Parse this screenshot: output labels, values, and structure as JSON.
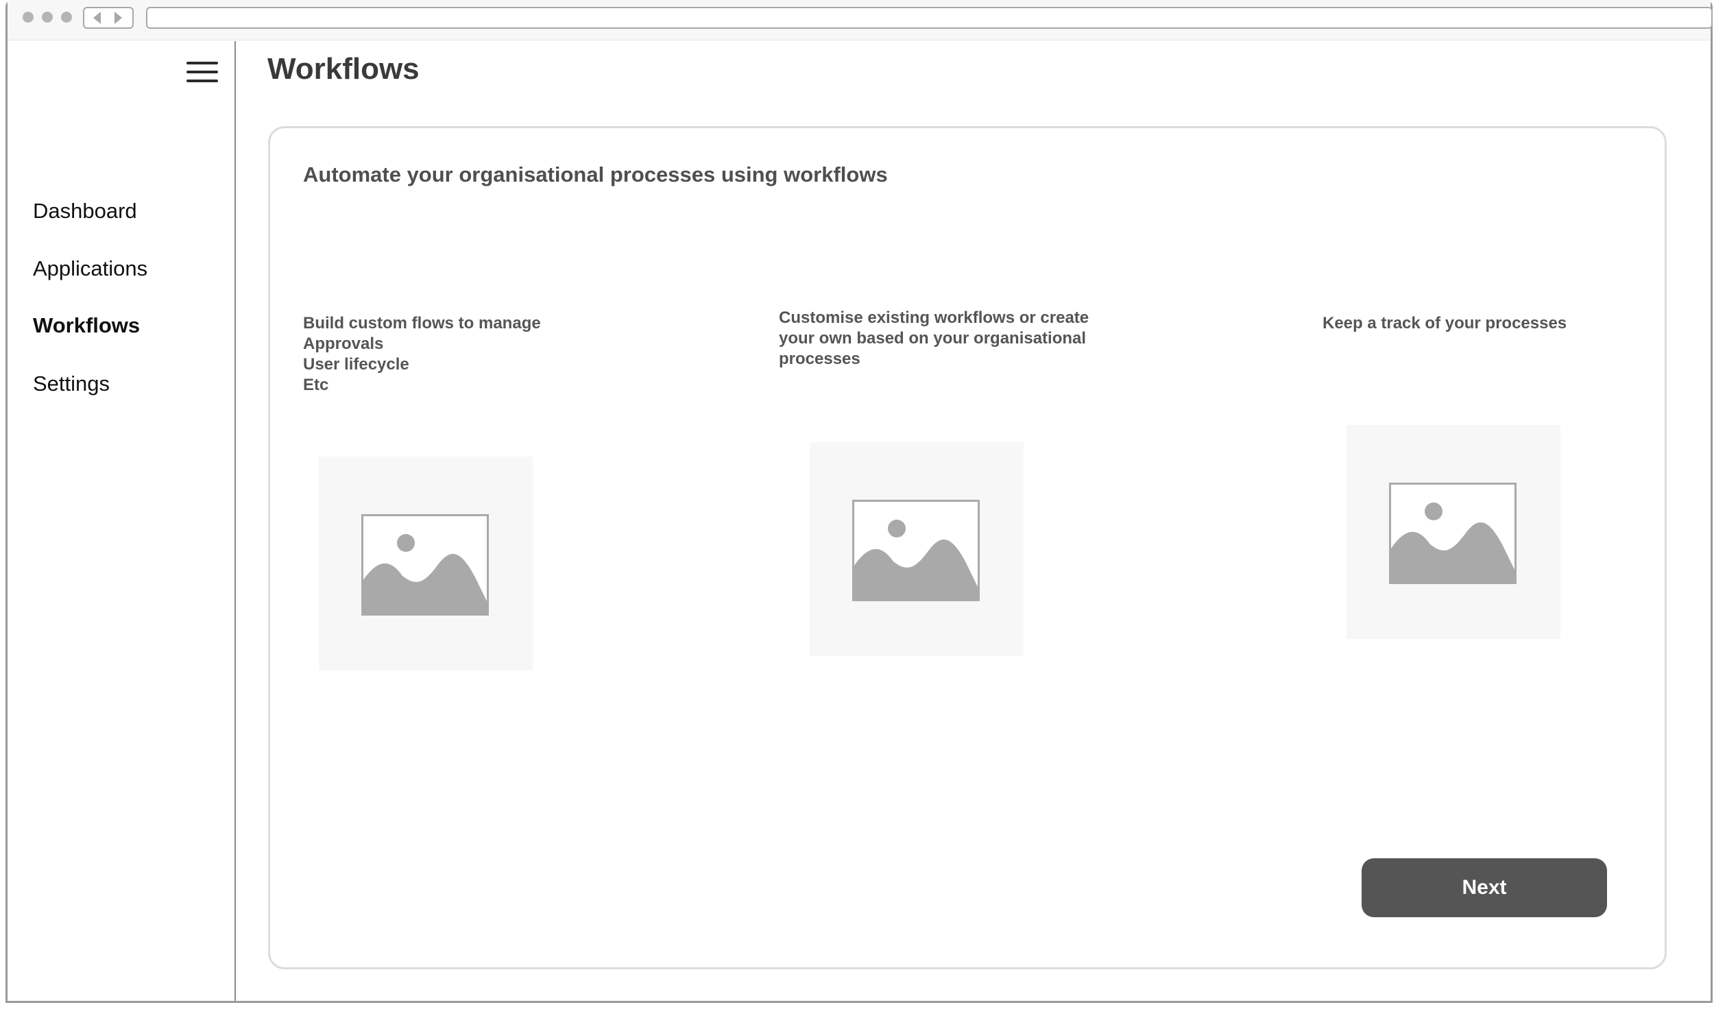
{
  "sidebar": {
    "menu_icon": "hamburger-menu-icon",
    "items": [
      {
        "label": "Dashboard",
        "active": false
      },
      {
        "label": "Applications",
        "active": false
      },
      {
        "label": "Workflows",
        "active": true
      },
      {
        "label": "Settings",
        "active": false
      }
    ]
  },
  "page": {
    "title": "Workflows"
  },
  "card": {
    "heading": "Automate your organisational processes using workflows",
    "features": [
      {
        "lines": [
          "Build custom flows to manage",
          "Approvals",
          "User lifecycle",
          "Etc"
        ],
        "image_icon": "image-placeholder-icon"
      },
      {
        "lines": [
          "Customise existing workflows or create",
          "your own based on your organisational",
          "processes"
        ],
        "image_icon": "image-placeholder-icon"
      },
      {
        "lines": [
          "Keep a track of your processes"
        ],
        "image_icon": "image-placeholder-icon"
      }
    ],
    "next_label": "Next"
  },
  "colors": {
    "button_background": "#555555",
    "button_text": "#ffffff",
    "placeholder_background": "#f7f7f7",
    "placeholder_icon": "#a9a9a9"
  }
}
